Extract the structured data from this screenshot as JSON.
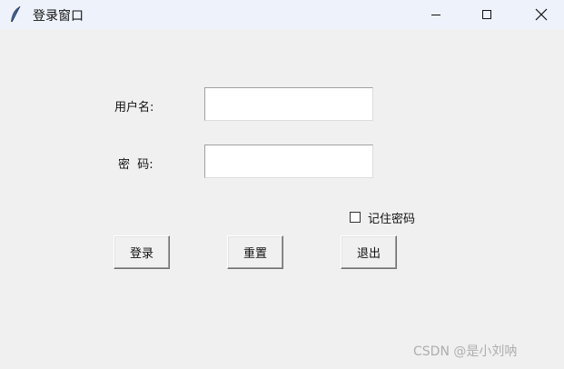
{
  "window": {
    "title": "登录窗口"
  },
  "form": {
    "username_label": "用户名:",
    "password_label": "密  码:",
    "username_value": "",
    "password_value": "",
    "remember_label": "记住密码",
    "remember_checked": false
  },
  "buttons": {
    "login": "登录",
    "reset": "重置",
    "exit": "退出"
  },
  "watermark": "CSDN @是小刘呐"
}
